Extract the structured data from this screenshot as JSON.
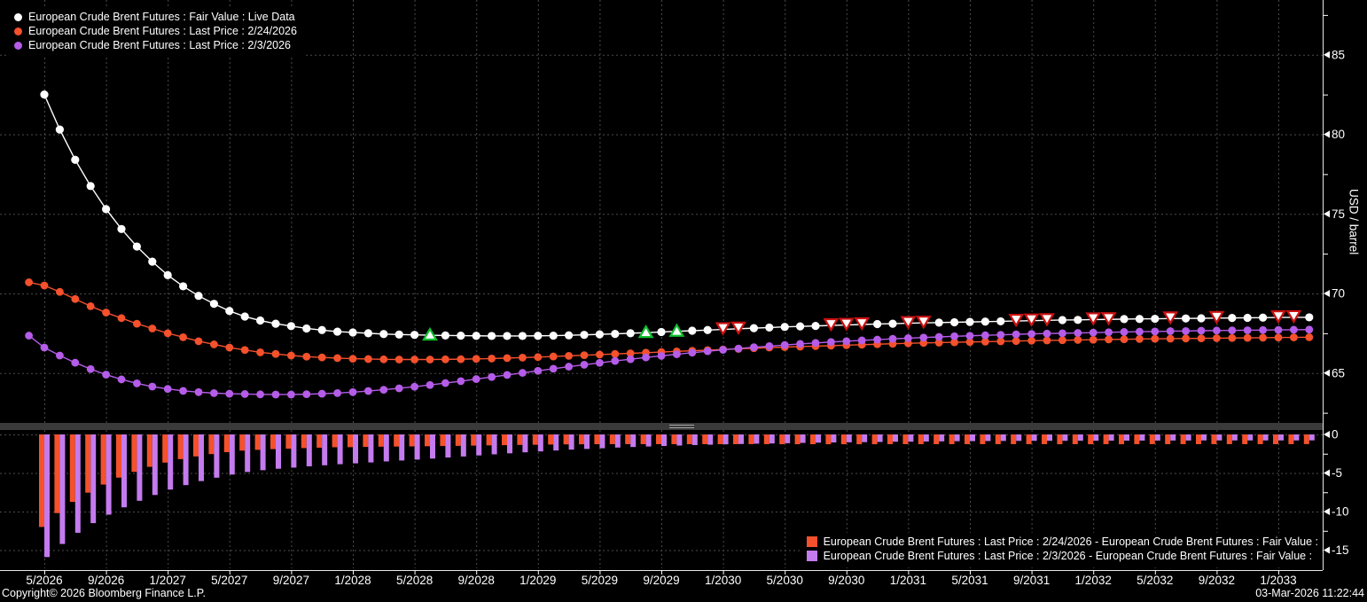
{
  "footer": {
    "copyright": "Copyright© 2026 Bloomberg Finance L.P.",
    "timestamp": "03-Mar-2026 11:22:44"
  },
  "colors": {
    "background": "#000000",
    "grid": "#4b4b4b",
    "axis_line": "#e8e8e8",
    "tick_text": "#ffffff",
    "divider": "#3a3a3a",
    "divider_handle": "#a9a9a9",
    "fair_value": "#ffffff",
    "last_2_24": "#f4512c",
    "last_2_3": "#b55ce8",
    "bar_2_24": "#f4512c",
    "bar_2_3": "#c47bee",
    "marker_up": "#0fbf2f",
    "marker_down": "#cc1111"
  },
  "legend_top": {
    "items": [
      {
        "label": "European Crude Brent Futures : Fair Value : Live Data"
      },
      {
        "label": "European Crude Brent Futures : Last Price : 2/24/2026"
      },
      {
        "label": "European Crude Brent Futures : Last Price : 2/3/2026"
      }
    ]
  },
  "legend_bottom": {
    "items": [
      {
        "label": "European Crude Brent Futures : Last Price : 2/24/2026 - European Crude Brent Futures : Fair Value :"
      },
      {
        "label": "European Crude Brent Futures : Last Price : 2/3/2026 - European Crude Brent Futures : Fair Value :"
      }
    ]
  },
  "axes": {
    "y_label": "USD / barrel",
    "x_tick_labels": [
      "5/2026",
      "9/2026",
      "1/2027",
      "5/2027",
      "9/2027",
      "1/2028",
      "5/2028",
      "9/2028",
      "1/2029",
      "5/2029",
      "9/2029",
      "1/2030",
      "5/2030",
      "9/2030",
      "1/2031",
      "5/2031",
      "9/2031",
      "1/2032",
      "5/2032",
      "9/2032",
      "1/2033"
    ],
    "top_major_ticks": [
      85,
      80,
      75,
      70,
      65
    ],
    "top_minor_ticks": [
      87.5,
      82.5,
      77.5,
      72.5,
      67.5,
      62.5
    ],
    "bottom_major_ticks": [
      0,
      -5,
      -10,
      -15
    ],
    "bottom_minor_ticks": [
      -2.5,
      -7.5,
      -12.5
    ]
  },
  "chart_data": {
    "type": "line+bar",
    "x_start": "5/2026",
    "x_interval": "1 month",
    "x_tick_labels": [
      "5/2026",
      "9/2026",
      "1/2027",
      "5/2027",
      "9/2027",
      "1/2028",
      "5/2028",
      "9/2028",
      "1/2029",
      "5/2029",
      "9/2029",
      "1/2030",
      "5/2030",
      "9/2030",
      "1/2031",
      "5/2031",
      "9/2031",
      "1/2032",
      "5/2032",
      "9/2032",
      "1/2033"
    ],
    "top_panel": {
      "type": "line",
      "ylabel": "USD / barrel",
      "ylim": [
        61.5,
        88.5
      ],
      "yticks": [
        65,
        70,
        75,
        80,
        85
      ],
      "grid": true,
      "series": [
        {
          "name": "European Crude Brent Futures : Fair Value : Live Data",
          "color": "#ffffff",
          "month_offset": 0,
          "values": [
            82.5,
            80.3,
            78.4,
            76.75,
            75.3,
            74.05,
            72.95,
            72,
            71.15,
            70.45,
            69.85,
            69.35,
            68.9,
            68.55,
            68.3,
            68.1,
            67.95,
            67.8,
            67.7,
            67.6,
            67.55,
            67.5,
            67.45,
            67.42,
            67.4,
            67.38,
            67.36,
            67.35,
            67.34,
            67.33,
            67.33,
            67.33,
            67.34,
            67.35,
            67.37,
            67.4,
            67.43,
            67.46,
            67.5,
            67.54,
            67.58,
            67.62,
            67.66,
            67.7,
            67.74,
            67.78,
            67.82,
            67.86,
            67.9,
            67.93,
            67.96,
            67.99,
            68.02,
            68.05,
            68.08,
            68.1,
            68.13,
            68.15,
            68.17,
            68.19,
            68.21,
            68.23,
            68.25,
            68.27,
            68.29,
            68.31,
            68.33,
            68.34,
            68.36,
            68.37,
            68.39,
            68.4,
            68.41,
            68.42,
            68.43,
            68.44,
            68.45,
            68.46,
            68.47,
            68.48,
            68.49,
            68.5,
            68.5
          ]
        },
        {
          "name": "European Crude Brent Futures : Last Price : 2/24/2026",
          "color": "#f4512c",
          "month_offset": -1,
          "values": [
            70.7,
            70.5,
            70.1,
            69.65,
            69.2,
            68.8,
            68.45,
            68.1,
            67.8,
            67.5,
            67.25,
            67,
            66.8,
            66.6,
            66.45,
            66.3,
            66.2,
            66.1,
            66.03,
            65.98,
            65.94,
            65.9,
            65.88,
            65.86,
            65.85,
            65.85,
            65.85,
            65.86,
            65.87,
            65.89,
            65.91,
            65.94,
            65.97,
            66,
            66.04,
            66.08,
            66.12,
            66.16,
            66.2,
            66.24,
            66.28,
            66.32,
            66.36,
            66.4,
            66.44,
            66.48,
            66.52,
            66.56,
            66.6,
            66.63,
            66.66,
            66.69,
            66.72,
            66.75,
            66.78,
            66.81,
            66.84,
            66.87,
            66.89,
            66.91,
            66.93,
            66.95,
            66.97,
            66.99,
            67.01,
            67.03,
            67.05,
            67.06,
            67.08,
            67.09,
            67.11,
            67.12,
            67.14,
            67.15,
            67.16,
            67.17,
            67.18,
            67.19,
            67.2,
            67.21,
            67.22,
            67.23,
            67.24,
            67.25
          ]
        },
        {
          "name": "European Crude Brent Futures : Last Price : 2/3/2026",
          "color": "#b55ce8",
          "month_offset": -1,
          "values": [
            67.35,
            66.6,
            66.1,
            65.65,
            65.25,
            64.9,
            64.6,
            64.35,
            64.15,
            64,
            63.88,
            63.8,
            63.74,
            63.7,
            63.68,
            63.66,
            63.65,
            63.65,
            63.67,
            63.7,
            63.74,
            63.8,
            63.87,
            63.95,
            64.04,
            64.14,
            64.25,
            64.37,
            64.49,
            64.62,
            64.75,
            64.88,
            65.01,
            65.14,
            65.27,
            65.4,
            65.52,
            65.64,
            65.76,
            65.87,
            65.98,
            66.08,
            66.18,
            66.28,
            66.37,
            66.46,
            66.54,
            66.62,
            66.69,
            66.76,
            66.83,
            66.89,
            66.95,
            67,
            67.05,
            67.1,
            67.15,
            67.19,
            67.23,
            67.27,
            67.31,
            67.34,
            67.37,
            67.4,
            67.43,
            67.46,
            67.48,
            67.5,
            67.52,
            67.54,
            67.56,
            67.58,
            67.6,
            67.61,
            67.63,
            67.64,
            67.66,
            67.67,
            67.68,
            67.69,
            67.7,
            67.71,
            67.72,
            67.73
          ]
        }
      ],
      "markers": {
        "green_up_triangle_month_index": [
          25,
          39,
          41
        ],
        "red_down_triangle_month_index": [
          44,
          45,
          51,
          52,
          53,
          56,
          57,
          63,
          64,
          65,
          68,
          69,
          73,
          76,
          80,
          81
        ]
      }
    },
    "bottom_panel": {
      "type": "bar",
      "ylim": [
        -17.5,
        0.5
      ],
      "yticks": [
        0,
        -5,
        -10,
        -15
      ],
      "grid": true,
      "series": [
        {
          "name": "European Crude Brent Futures : Last Price : 2/24/2026 - European Crude Brent Futures : Fair Value :",
          "color": "#f4512c",
          "derived": "last_2_24 minus fair_value, monthly"
        },
        {
          "name": "European Crude Brent Futures : Last Price : 2/3/2026 - European Crude Brent Futures : Fair Value :",
          "color": "#c47bee",
          "derived": "last_2_3 minus fair_value, monthly"
        }
      ]
    }
  }
}
